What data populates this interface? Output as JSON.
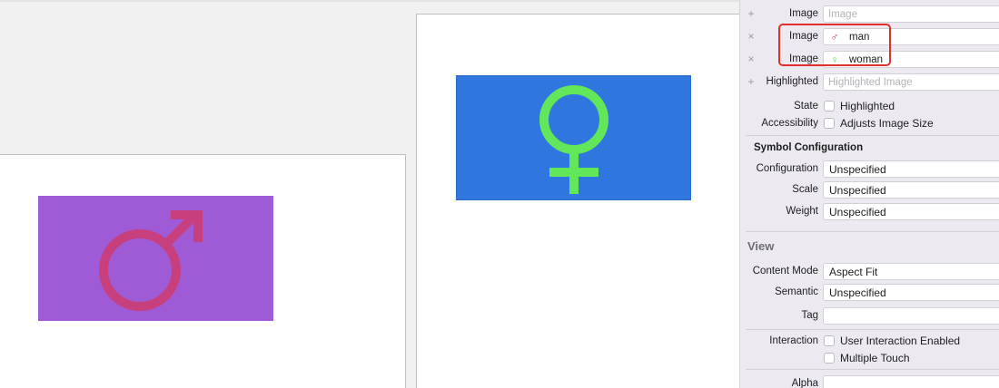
{
  "canvas": {
    "man_view": {
      "symbol": "male-sign",
      "background": "#9f5bd6",
      "symbol_color": "#c83f7e"
    },
    "woman_view": {
      "symbol": "female-sign",
      "background": "#2f77df",
      "symbol_color": "#62e65a"
    }
  },
  "inspector": {
    "image_rows": [
      {
        "button": "+",
        "label": "Image",
        "placeholder": "Image",
        "value": "",
        "icon": ""
      },
      {
        "button": "×",
        "label": "Image",
        "placeholder": "",
        "value": "man",
        "icon": "♂"
      },
      {
        "button": "×",
        "label": "Image",
        "placeholder": "",
        "value": "woman",
        "icon": "♀"
      },
      {
        "button": "+",
        "label": "Highlighted",
        "placeholder": "Highlighted Image",
        "value": "",
        "icon": ""
      }
    ],
    "state": {
      "label": "State",
      "checkbox_text": "Highlighted"
    },
    "accessibility": {
      "label": "Accessibility",
      "checkbox_text": "Adjusts Image Size"
    },
    "symbol_configuration": {
      "title": "Symbol Configuration",
      "configuration": {
        "label": "Configuration",
        "value": "Unspecified"
      },
      "scale": {
        "label": "Scale",
        "value": "Unspecified"
      },
      "weight": {
        "label": "Weight",
        "value": "Unspecified"
      }
    },
    "view": {
      "title": "View",
      "content_mode": {
        "label": "Content Mode",
        "value": "Aspect Fit"
      },
      "semantic": {
        "label": "Semantic",
        "value": "Unspecified"
      },
      "tag": {
        "label": "Tag",
        "value": ""
      },
      "interaction": {
        "label": "Interaction",
        "options": [
          "User Interaction Enabled",
          "Multiple Touch"
        ]
      },
      "alpha": {
        "label": "Alpha",
        "value": ""
      }
    }
  },
  "colors": {
    "highlight": "#e0302b",
    "panel": "#eceaf0"
  }
}
